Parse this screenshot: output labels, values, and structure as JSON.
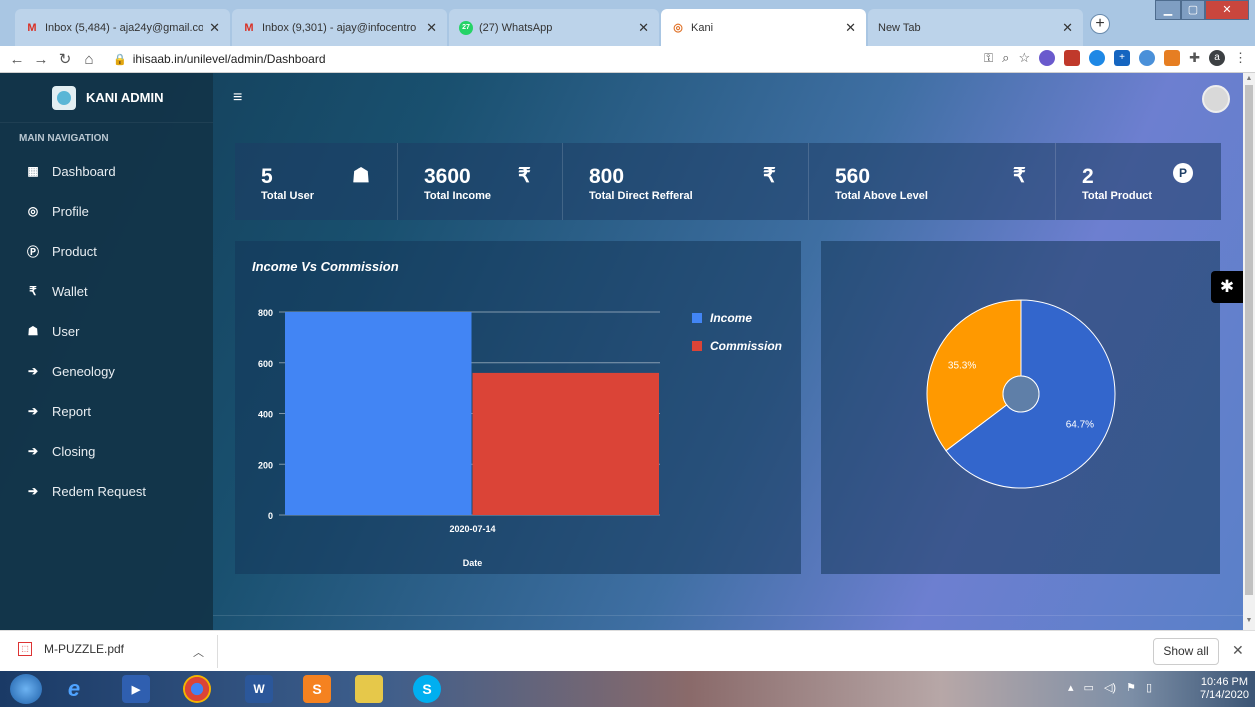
{
  "browser": {
    "tabs": [
      {
        "title": "Inbox (5,484) - aja24y@gmail.co",
        "icon": "gmail-icon",
        "active": false
      },
      {
        "title": "Inbox (9,301) - ajay@infocentro",
        "icon": "gmail-icon",
        "active": false
      },
      {
        "title": "(27) WhatsApp",
        "icon": "whatsapp-icon",
        "badge": "27",
        "active": false
      },
      {
        "title": "Kani",
        "icon": "kani-icon",
        "active": true
      },
      {
        "title": "New Tab",
        "icon": "",
        "active": false
      }
    ],
    "url": "ihisaab.in/unilevel/admin/Dashboard",
    "profile_initial": "a"
  },
  "sidebar": {
    "brand": "KANI ADMIN",
    "section_header": "MAIN NAVIGATION",
    "items": [
      {
        "label": "Dashboard",
        "icon": "dashboard-icon",
        "glyph": "▦"
      },
      {
        "label": "Profile",
        "icon": "profile-icon",
        "glyph": "◎"
      },
      {
        "label": "Product",
        "icon": "product-icon",
        "glyph": "Ⓟ"
      },
      {
        "label": "Wallet",
        "icon": "rupee-icon",
        "glyph": "₹"
      },
      {
        "label": "User",
        "icon": "user-icon",
        "glyph": "☗"
      },
      {
        "label": "Geneology",
        "icon": "arrow-right-icon",
        "glyph": "➔"
      },
      {
        "label": "Report",
        "icon": "arrow-right-icon",
        "glyph": "➔"
      },
      {
        "label": "Closing",
        "icon": "arrow-right-icon",
        "glyph": "➔"
      },
      {
        "label": "Redem Request",
        "icon": "arrow-right-icon",
        "glyph": "➔"
      }
    ]
  },
  "stats": [
    {
      "value": "5",
      "label": "Total User",
      "icon": "user-icon",
      "glyph": "☗"
    },
    {
      "value": "3600",
      "label": "Total Income",
      "icon": "rupee-icon",
      "glyph": "₹"
    },
    {
      "value": "800",
      "label": "Total Direct Refferal",
      "icon": "rupee-icon",
      "glyph": "₹"
    },
    {
      "value": "560",
      "label": "Total Above Level",
      "icon": "rupee-icon",
      "glyph": "₹"
    },
    {
      "value": "2",
      "label": "Total Product",
      "icon": "product-icon",
      "glyph": "P"
    }
  ],
  "chart_data": [
    {
      "type": "bar",
      "title": "Income Vs Commission",
      "categories": [
        "2020-07-14"
      ],
      "xlabel": "Date",
      "ylabel": "",
      "ylim": [
        0,
        800
      ],
      "yticks": [
        0,
        200,
        400,
        600,
        800
      ],
      "series": [
        {
          "name": "Income",
          "values": [
            800
          ],
          "color": "#4285f4"
        },
        {
          "name": "Commission",
          "values": [
            560
          ],
          "color": "#db4437"
        }
      ],
      "legend": "right"
    },
    {
      "type": "pie",
      "donut": true,
      "slices": [
        {
          "label": "64.7%",
          "value": 64.7,
          "color": "#3366cc"
        },
        {
          "label": "35.3%",
          "value": 35.3,
          "color": "#ff9900"
        }
      ]
    }
  ],
  "downloads": {
    "file": "M-PUZZLE.pdf",
    "show_all": "Show all"
  },
  "taskbar": {
    "time": "10:46 PM",
    "date": "7/14/2020"
  }
}
